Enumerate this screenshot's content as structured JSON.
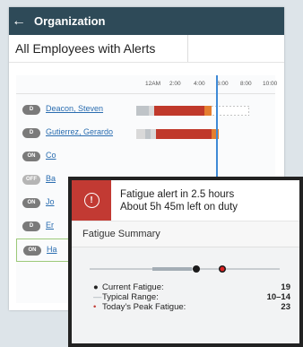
{
  "header": {
    "title": "Organization",
    "back_icon": "back-arrow-icon"
  },
  "filter": {
    "value": "All Employees with Alerts"
  },
  "timeline": {
    "ticks": [
      "12AM",
      "2:00",
      "4:00",
      "6:00",
      "8:00",
      "10:00"
    ]
  },
  "employees": [
    {
      "status": "D",
      "name": "Deacon, Steven"
    },
    {
      "status": "D",
      "name": "Gutierrez, Gerardo"
    },
    {
      "status": "ON",
      "name": "Co"
    },
    {
      "status": "OFF",
      "name": "Ba"
    },
    {
      "status": "ON",
      "name": "Jo"
    },
    {
      "status": "D",
      "name": "Er"
    },
    {
      "status": "ON",
      "name": "Ha"
    }
  ],
  "popup": {
    "alert_line1": "Fatigue alert in 2.5 hours",
    "alert_line2": "About 5h 45m left on duty",
    "summary_title": "Fatigue Summary",
    "current_label": "Current Fatigue:",
    "current_value": "19",
    "range_label": "Typical Range:",
    "range_value": "10–14",
    "peak_label": "Today’s Peak Fatigue:",
    "peak_value": "23"
  },
  "colors": {
    "header": "#2e4a58",
    "alert": "#c23a33",
    "now_line": "#3f8ad6",
    "bar_red": "#c0392b",
    "bar_orange": "#e47e30"
  }
}
